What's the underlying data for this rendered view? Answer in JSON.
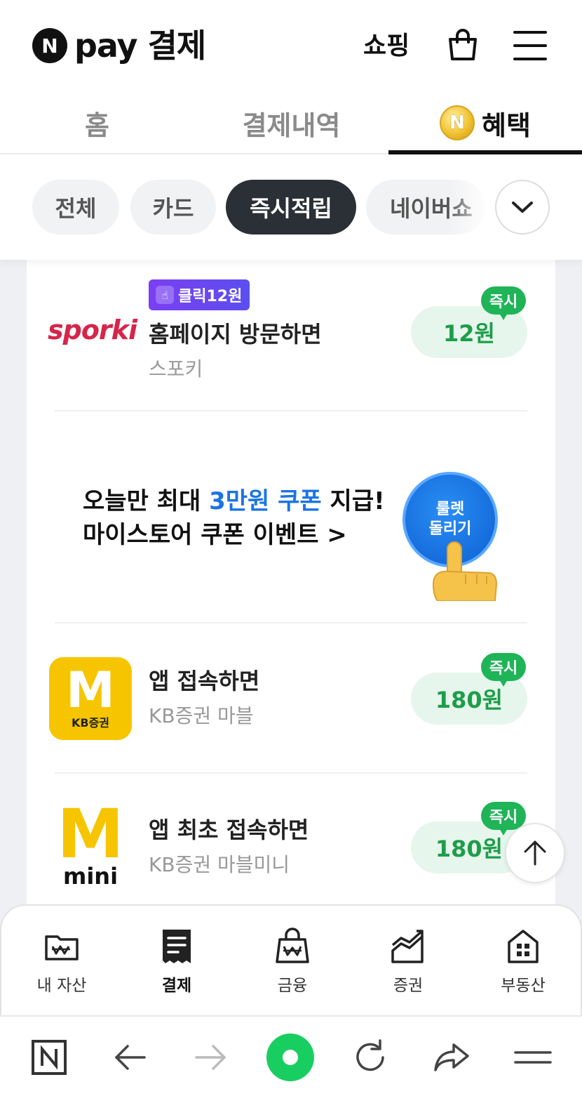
{
  "header": {
    "logo_mark": "N",
    "logo_text": "pay 결제",
    "shop_label": "쇼핑"
  },
  "tabs": [
    {
      "label": "홈",
      "active": false
    },
    {
      "label": "결제내역",
      "active": false
    },
    {
      "label": "혜택",
      "active": true
    }
  ],
  "coin_mark": "N",
  "filters": {
    "chips": [
      {
        "label": "전체",
        "active": false
      },
      {
        "label": "카드",
        "active": false
      },
      {
        "label": "즉시적립",
        "active": true
      },
      {
        "label": "네이버쇼",
        "active": false
      }
    ]
  },
  "items": [
    {
      "badge": "클릭12원",
      "logo_text": "sporki",
      "title": "홈페이지 방문하면",
      "subtitle": "스포키",
      "reward": "12원",
      "instant_label": "즉시"
    },
    {
      "logo_main": "M",
      "logo_sub": "KB증권",
      "title": "앱 접속하면",
      "subtitle": "KB증권 마블",
      "reward": "180원",
      "instant_label": "즉시"
    },
    {
      "logo_main": "M",
      "logo_sub": "mini",
      "title": "앱 최초 접속하면",
      "subtitle": "KB증권 마블미니",
      "reward": "180원",
      "instant_label": "즉시"
    }
  ],
  "banner": {
    "line1_a": "오늘만 최대 ",
    "line1_highlight": "3만원 쿠폰",
    "line1_b": " 지급!",
    "line2": "마이스토어 쿠폰 이벤트 >",
    "roulette_line1": "룰렛",
    "roulette_line2": "돌리기"
  },
  "bottom_nav": [
    {
      "label": "내 자산",
      "icon": "wallet-icon",
      "active": false
    },
    {
      "label": "결제",
      "icon": "receipt-icon",
      "active": true
    },
    {
      "label": "금융",
      "icon": "money-bag-icon",
      "active": false
    },
    {
      "label": "증권",
      "icon": "stock-chart-icon",
      "active": false
    },
    {
      "label": "부동산",
      "icon": "building-icon",
      "active": false
    }
  ],
  "browser": {
    "home_mark": "N"
  },
  "colors": {
    "reward_green": "#1e9d4a",
    "reward_bg": "#e6f6ec",
    "chip_active": "#2b2f36",
    "highlight_blue": "#1b74e4",
    "browser_green": "#19ce60"
  }
}
